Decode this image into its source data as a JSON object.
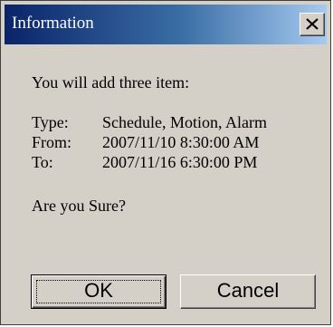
{
  "window": {
    "title": "Information",
    "close_icon": "close-x-icon"
  },
  "message": {
    "intro": "You will add three item:",
    "type_label": "Type:",
    "type_value": "Schedule, Motion, Alarm",
    "from_label": "From:",
    "from_value": "2007/11/10 8:30:00 AM",
    "to_label": "To:",
    "to_value": "2007/11/16 6:30:00 PM",
    "question": "Are you Sure?"
  },
  "buttons": {
    "ok_label": "OK",
    "cancel_label": "Cancel"
  },
  "colors": {
    "titlebar_start": "#0a246a",
    "titlebar_end": "#a6caf0",
    "dialog_face": "#d4d0c8"
  }
}
